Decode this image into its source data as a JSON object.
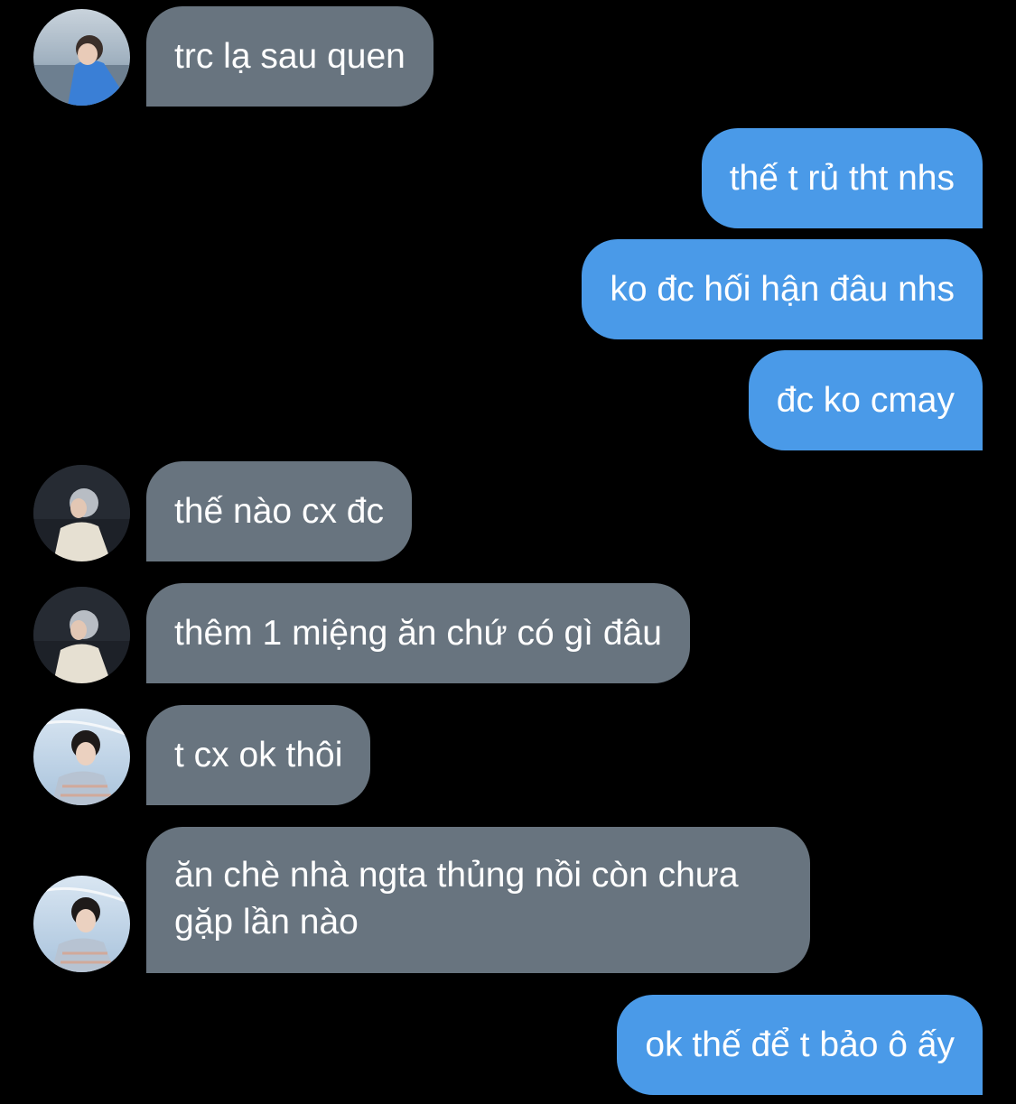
{
  "conversation": {
    "messages": [
      {
        "sender": "them",
        "avatar": "avatar-a",
        "text": "trc lạ sau quen"
      },
      {
        "sender": "me",
        "text": "thế t rủ tht nhs"
      },
      {
        "sender": "me",
        "text": "ko đc hối hận đâu nhs"
      },
      {
        "sender": "me",
        "text": "đc ko cmay"
      },
      {
        "sender": "them",
        "avatar": "avatar-b",
        "text": "thế nào cx đc"
      },
      {
        "sender": "them",
        "avatar": "avatar-b",
        "text": "thêm 1 miệng ăn chứ có gì đâu"
      },
      {
        "sender": "them",
        "avatar": "avatar-c",
        "text": "t cx ok thôi"
      },
      {
        "sender": "them",
        "avatar": "avatar-c",
        "text": "ăn chè nhà ngta thủng nồi còn chưa gặp lần nào"
      },
      {
        "sender": "me",
        "text": "ok thế để t bảo ô ấy"
      }
    ]
  },
  "colors": {
    "background": "#000000",
    "incoming_bubble": "#68747f",
    "outgoing_bubble": "#4a9ae8",
    "text": "#ffffff"
  }
}
